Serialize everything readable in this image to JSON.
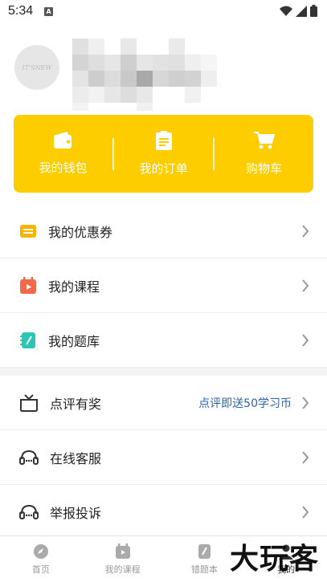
{
  "status_bar": {
    "time": "5:34",
    "notif_glyph": "A"
  },
  "profile": {
    "avatar_text": "IT'SNEW"
  },
  "quick_actions": [
    {
      "label": "我的钱包",
      "icon": "wallet-icon"
    },
    {
      "label": "我的订单",
      "icon": "clipboard-icon"
    },
    {
      "label": "购物车",
      "icon": "cart-icon"
    }
  ],
  "menu": {
    "group1": [
      {
        "label": "我的优惠券",
        "icon": "coupon-icon",
        "color": "#f7b500"
      },
      {
        "label": "我的课程",
        "icon": "calendar-icon",
        "color": "#f26a4b"
      },
      {
        "label": "我的题库",
        "icon": "notebook-icon",
        "color": "#2cc6b5"
      }
    ],
    "group2": [
      {
        "label": "点评有奖",
        "icon": "gift-icon",
        "extra": "点评即送50学习币"
      },
      {
        "label": "在线客服",
        "icon": "headset-icon"
      },
      {
        "label": "举报投诉",
        "icon": "headset-icon"
      }
    ]
  },
  "tabs": [
    {
      "label": "首页",
      "icon": "compass-icon"
    },
    {
      "label": "我的课程",
      "icon": "calendar-icon"
    },
    {
      "label": "错题本",
      "icon": "notebook-icon"
    },
    {
      "label": "我的",
      "icon": "user-icon"
    }
  ],
  "watermark": "大玩客",
  "colors": {
    "accent": "#fecd00",
    "link": "#2a63ad"
  }
}
